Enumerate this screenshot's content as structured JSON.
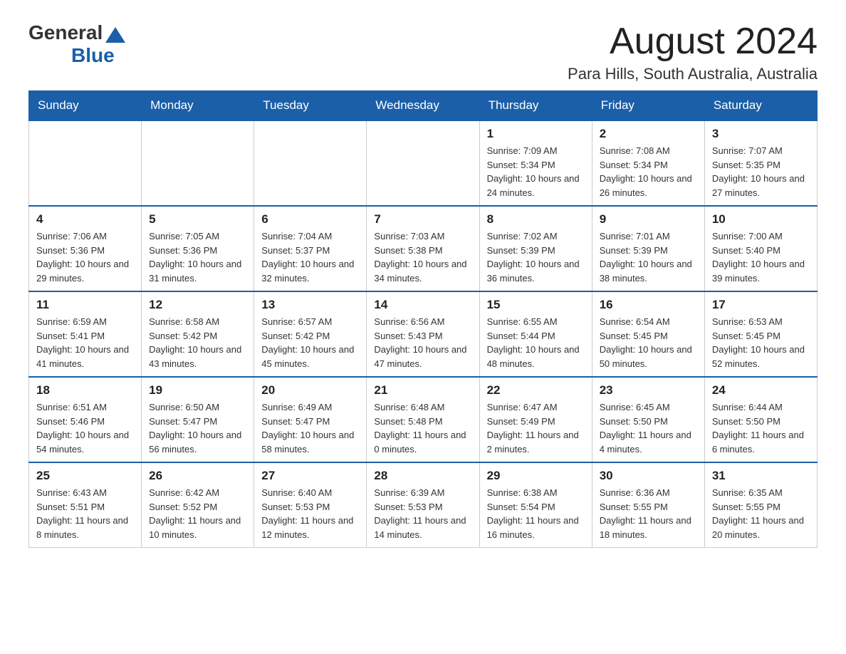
{
  "header": {
    "logo": {
      "general": "General",
      "blue": "Blue"
    },
    "title": "August 2024",
    "location": "Para Hills, South Australia, Australia"
  },
  "calendar": {
    "days": [
      "Sunday",
      "Monday",
      "Tuesday",
      "Wednesday",
      "Thursday",
      "Friday",
      "Saturday"
    ],
    "weeks": [
      [
        {
          "day": "",
          "info": ""
        },
        {
          "day": "",
          "info": ""
        },
        {
          "day": "",
          "info": ""
        },
        {
          "day": "",
          "info": ""
        },
        {
          "day": "1",
          "info": "Sunrise: 7:09 AM\nSunset: 5:34 PM\nDaylight: 10 hours and 24 minutes."
        },
        {
          "day": "2",
          "info": "Sunrise: 7:08 AM\nSunset: 5:34 PM\nDaylight: 10 hours and 26 minutes."
        },
        {
          "day": "3",
          "info": "Sunrise: 7:07 AM\nSunset: 5:35 PM\nDaylight: 10 hours and 27 minutes."
        }
      ],
      [
        {
          "day": "4",
          "info": "Sunrise: 7:06 AM\nSunset: 5:36 PM\nDaylight: 10 hours and 29 minutes."
        },
        {
          "day": "5",
          "info": "Sunrise: 7:05 AM\nSunset: 5:36 PM\nDaylight: 10 hours and 31 minutes."
        },
        {
          "day": "6",
          "info": "Sunrise: 7:04 AM\nSunset: 5:37 PM\nDaylight: 10 hours and 32 minutes."
        },
        {
          "day": "7",
          "info": "Sunrise: 7:03 AM\nSunset: 5:38 PM\nDaylight: 10 hours and 34 minutes."
        },
        {
          "day": "8",
          "info": "Sunrise: 7:02 AM\nSunset: 5:39 PM\nDaylight: 10 hours and 36 minutes."
        },
        {
          "day": "9",
          "info": "Sunrise: 7:01 AM\nSunset: 5:39 PM\nDaylight: 10 hours and 38 minutes."
        },
        {
          "day": "10",
          "info": "Sunrise: 7:00 AM\nSunset: 5:40 PM\nDaylight: 10 hours and 39 minutes."
        }
      ],
      [
        {
          "day": "11",
          "info": "Sunrise: 6:59 AM\nSunset: 5:41 PM\nDaylight: 10 hours and 41 minutes."
        },
        {
          "day": "12",
          "info": "Sunrise: 6:58 AM\nSunset: 5:42 PM\nDaylight: 10 hours and 43 minutes."
        },
        {
          "day": "13",
          "info": "Sunrise: 6:57 AM\nSunset: 5:42 PM\nDaylight: 10 hours and 45 minutes."
        },
        {
          "day": "14",
          "info": "Sunrise: 6:56 AM\nSunset: 5:43 PM\nDaylight: 10 hours and 47 minutes."
        },
        {
          "day": "15",
          "info": "Sunrise: 6:55 AM\nSunset: 5:44 PM\nDaylight: 10 hours and 48 minutes."
        },
        {
          "day": "16",
          "info": "Sunrise: 6:54 AM\nSunset: 5:45 PM\nDaylight: 10 hours and 50 minutes."
        },
        {
          "day": "17",
          "info": "Sunrise: 6:53 AM\nSunset: 5:45 PM\nDaylight: 10 hours and 52 minutes."
        }
      ],
      [
        {
          "day": "18",
          "info": "Sunrise: 6:51 AM\nSunset: 5:46 PM\nDaylight: 10 hours and 54 minutes."
        },
        {
          "day": "19",
          "info": "Sunrise: 6:50 AM\nSunset: 5:47 PM\nDaylight: 10 hours and 56 minutes."
        },
        {
          "day": "20",
          "info": "Sunrise: 6:49 AM\nSunset: 5:47 PM\nDaylight: 10 hours and 58 minutes."
        },
        {
          "day": "21",
          "info": "Sunrise: 6:48 AM\nSunset: 5:48 PM\nDaylight: 11 hours and 0 minutes."
        },
        {
          "day": "22",
          "info": "Sunrise: 6:47 AM\nSunset: 5:49 PM\nDaylight: 11 hours and 2 minutes."
        },
        {
          "day": "23",
          "info": "Sunrise: 6:45 AM\nSunset: 5:50 PM\nDaylight: 11 hours and 4 minutes."
        },
        {
          "day": "24",
          "info": "Sunrise: 6:44 AM\nSunset: 5:50 PM\nDaylight: 11 hours and 6 minutes."
        }
      ],
      [
        {
          "day": "25",
          "info": "Sunrise: 6:43 AM\nSunset: 5:51 PM\nDaylight: 11 hours and 8 minutes."
        },
        {
          "day": "26",
          "info": "Sunrise: 6:42 AM\nSunset: 5:52 PM\nDaylight: 11 hours and 10 minutes."
        },
        {
          "day": "27",
          "info": "Sunrise: 6:40 AM\nSunset: 5:53 PM\nDaylight: 11 hours and 12 minutes."
        },
        {
          "day": "28",
          "info": "Sunrise: 6:39 AM\nSunset: 5:53 PM\nDaylight: 11 hours and 14 minutes."
        },
        {
          "day": "29",
          "info": "Sunrise: 6:38 AM\nSunset: 5:54 PM\nDaylight: 11 hours and 16 minutes."
        },
        {
          "day": "30",
          "info": "Sunrise: 6:36 AM\nSunset: 5:55 PM\nDaylight: 11 hours and 18 minutes."
        },
        {
          "day": "31",
          "info": "Sunrise: 6:35 AM\nSunset: 5:55 PM\nDaylight: 11 hours and 20 minutes."
        }
      ]
    ]
  }
}
